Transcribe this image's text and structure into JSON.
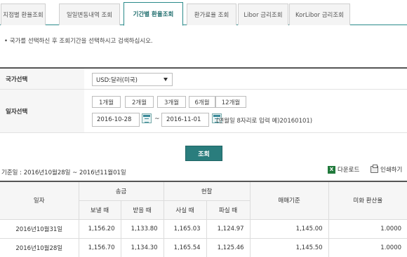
{
  "tabs": [
    {
      "label": "지점별 환율조회"
    },
    {
      "label": "일일변동내역 조회"
    },
    {
      "label": "기간별 환율조회"
    },
    {
      "label": "환가료율 조회"
    },
    {
      "label": "Libor 금리조회"
    },
    {
      "label": "KorLibor 금리조회"
    }
  ],
  "active_tab": 2,
  "notice": "• 국가를 선택하신 후 조회기간을 선택하시고 검색하십시오.",
  "form": {
    "country_label": "국가선택",
    "country_value": "USD:달러(미국)",
    "date_label": "일자선택",
    "periods": [
      "1개월",
      "2개월",
      "3개월",
      "6개월",
      "12개월"
    ],
    "start_date": "2016-10-28",
    "end_date": "2016-11-01",
    "tilde": "~",
    "hint": "(연월일 8자리로 입력 예)20160101)"
  },
  "search_button": "조회",
  "base_date": "기준일 : 2016년10월28일 ~ 2016년11월01일",
  "download_label": "다운로드",
  "print_label": "인쇄하기",
  "table": {
    "headers": {
      "date": "일자",
      "remit": "송금",
      "cash": "현찰",
      "base_rate": "매매기준",
      "usd_rate": "미화 환산율",
      "send": "보낼 때",
      "receive": "받을 때",
      "buy": "사실 때",
      "sell": "파실 때"
    },
    "rows": [
      {
        "date": "2016년10월31일",
        "send": "1,156.20",
        "receive": "1,133.80",
        "buy": "1,165.03",
        "sell": "1,124.97",
        "base": "1,145.00",
        "usd": "1.0000"
      },
      {
        "date": "2016년10월28일",
        "send": "1,156.70",
        "receive": "1,134.30",
        "buy": "1,165.54",
        "sell": "1,125.46",
        "base": "1,145.50",
        "usd": "1.0000"
      }
    ]
  }
}
